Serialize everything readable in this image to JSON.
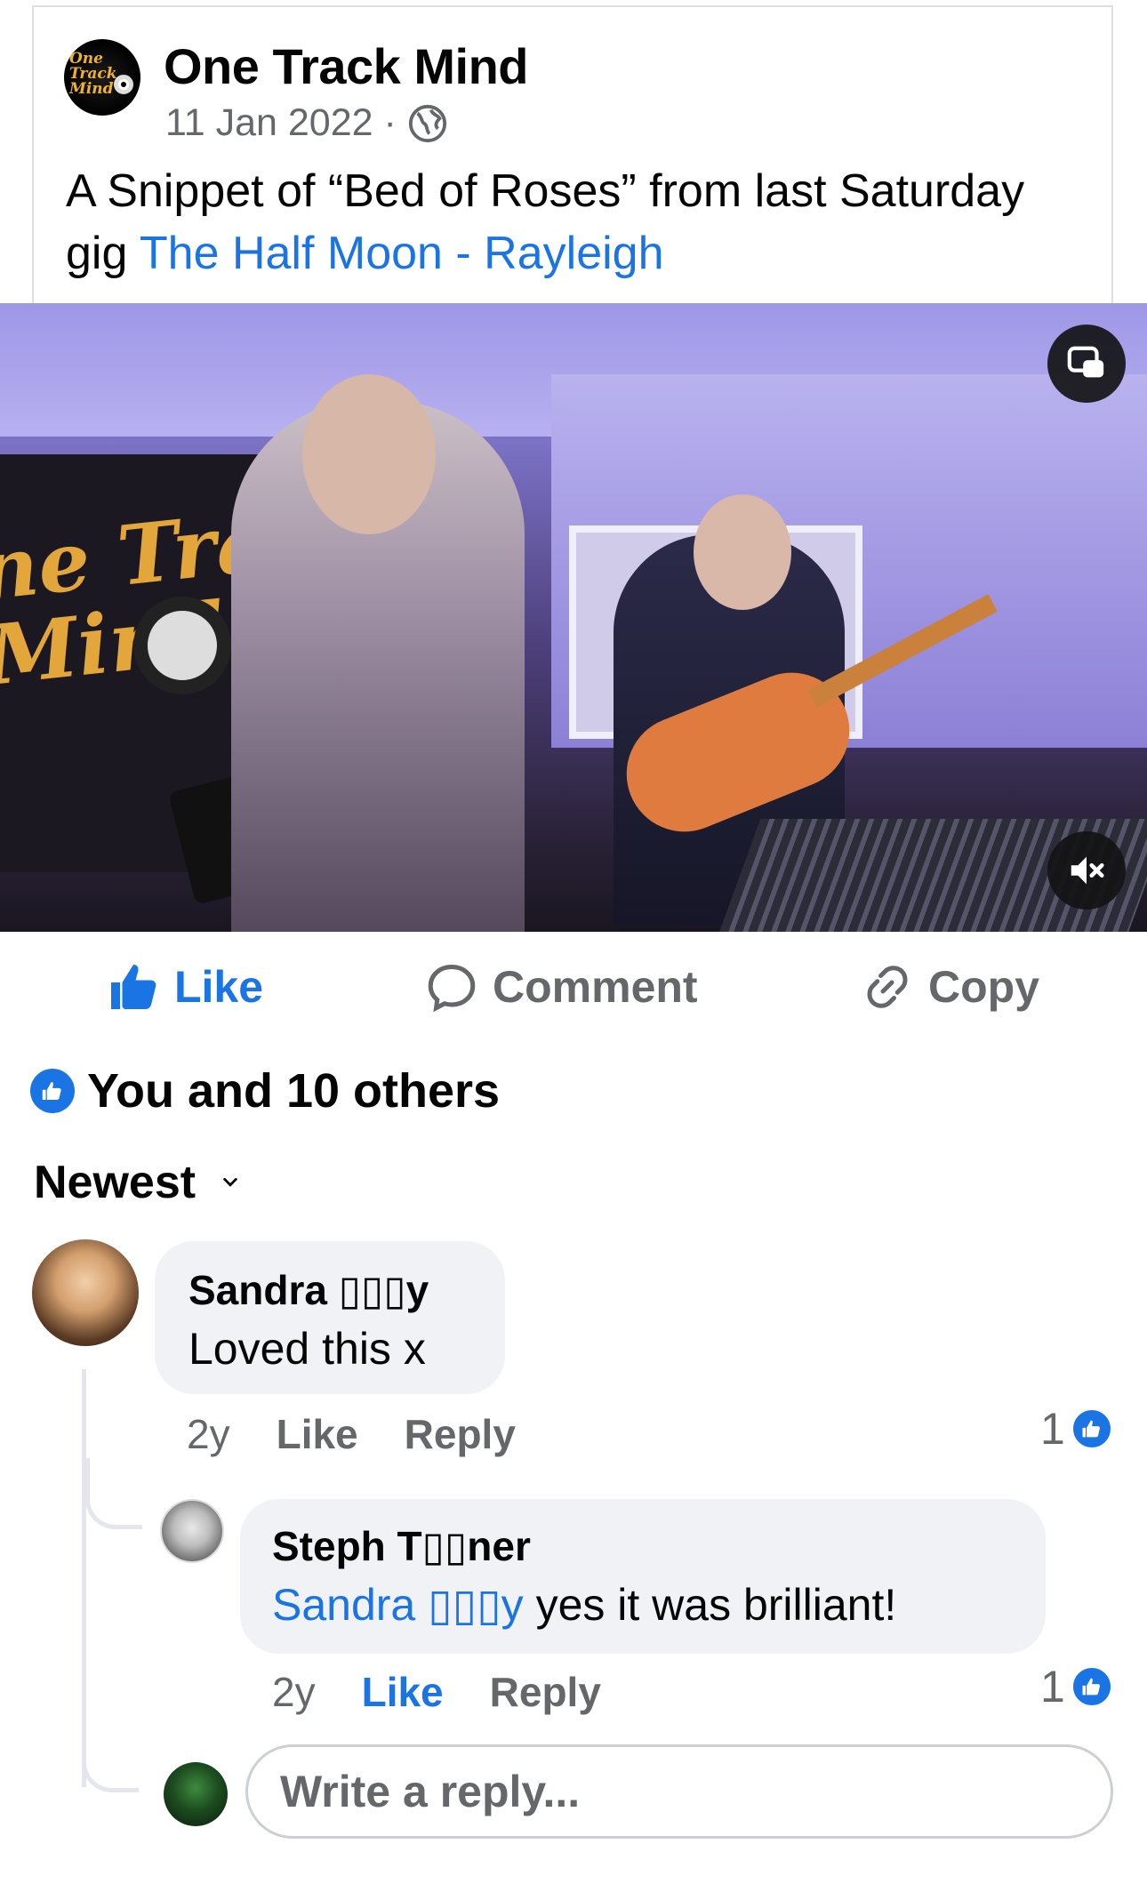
{
  "post": {
    "page_name": "One Track Mind",
    "date": "11 Jan 2022",
    "separator": "·",
    "privacy_icon": "globe-icon",
    "text": "A Snippet of “Bed of Roses” from last Saturday gig ",
    "location_link": "The Half Moon - Rayleigh",
    "avatar_logo_text": "One Track Mind"
  },
  "video": {
    "banner_text": "ne Track\nMind",
    "pip_icon": "picture-in-picture-icon",
    "mute_icon": "muted-speaker-icon",
    "muted": true
  },
  "actions": {
    "like": "Like",
    "comment": "Comment",
    "copy": "Copy",
    "like_active": true
  },
  "reactions_summary": "You and 10 others",
  "sort_label": "Newest",
  "comments": [
    {
      "author": "Sandra ▯▯▯y",
      "text": "Loved this x",
      "time": "2y",
      "like_label": "Like",
      "reply_label": "Reply",
      "reaction_count": "1",
      "liked": false
    },
    {
      "author": "Steph T▯▯ner",
      "mention": "Sandra ▯▯▯y",
      "text": " yes it was brilliant!",
      "time": "2y",
      "like_label": "Like",
      "reply_label": "Reply",
      "reaction_count": "1",
      "liked": true
    }
  ],
  "reply_placeholder": "Write a reply...",
  "colors": {
    "accent": "#1b74e4",
    "secondary_text": "#65676b",
    "bubble": "#f0f2f5"
  }
}
